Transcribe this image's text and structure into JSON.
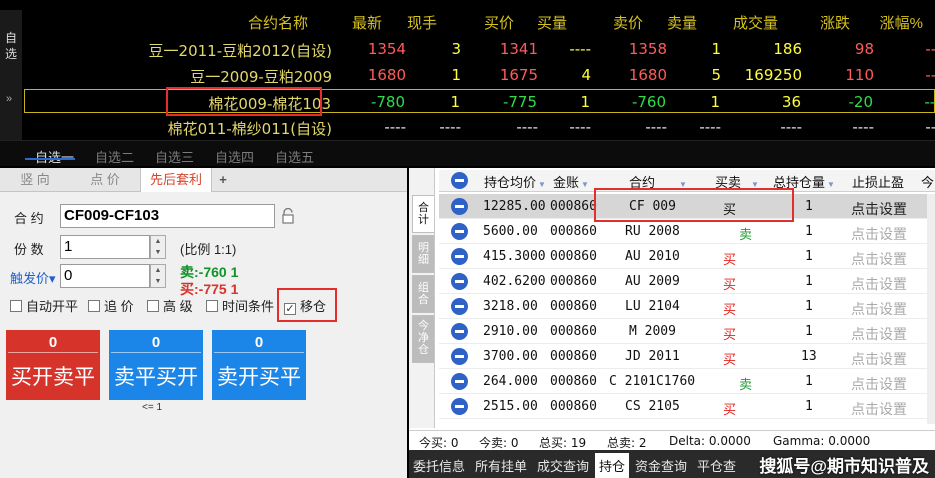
{
  "quote_board": {
    "side_tab": [
      "自",
      "选"
    ],
    "columns": [
      "合约名称",
      "最新",
      "现手",
      "买价",
      "买量",
      "卖价",
      "卖量",
      "成交量",
      "涨跌",
      "涨幅%"
    ],
    "rows": [
      {
        "name": "豆一2011-豆粕2012(自设)",
        "last": "1354",
        "vol": "3",
        "bid": "1341",
        "bid_qty": "----",
        "ask": "1358",
        "ask_qty": "1",
        "turnover": "186",
        "change": "98",
        "pct": "----"
      },
      {
        "name": "豆一2009-豆粕2009",
        "last": "1680",
        "vol": "1",
        "bid": "1675",
        "bid_qty": "4",
        "ask": "1680",
        "ask_qty": "5",
        "turnover": "169250",
        "change": "110",
        "pct": "----"
      },
      {
        "name": "棉花009-棉花103",
        "last": "-780",
        "vol": "1",
        "bid": "-775",
        "bid_qty": "1",
        "ask": "-760",
        "ask_qty": "1",
        "turnover": "36",
        "change": "-20",
        "pct": "----"
      },
      {
        "name": "棉花011-棉纱011(自设)",
        "last": "----",
        "vol": "----",
        "bid": "----",
        "bid_qty": "----",
        "ask": "----",
        "ask_qty": "----",
        "turnover": "----",
        "change": "----",
        "pct": "----"
      }
    ],
    "chevron": "»"
  },
  "watchlist_tabs": [
    "自选一",
    "自选二",
    "自选三",
    "自选四",
    "自选五"
  ],
  "order_panel": {
    "tabs": [
      "竖 向",
      "点 价",
      "先后套利",
      "+"
    ],
    "contract_label": "合 约",
    "contract_value": "CF009-CF103",
    "lots_label": "份 数",
    "lots_value": "1",
    "ratio": "(比例 1:1)",
    "trigger_label": "触发价▾",
    "trigger_value": "0",
    "sell_quote": "卖:-760  1",
    "buy_quote": "买:-775  1",
    "checkboxes": [
      {
        "label": "自动开平",
        "checked": false
      },
      {
        "label": "追 价",
        "checked": false
      },
      {
        "label": "高 级",
        "checked": false
      },
      {
        "label": "时间条件",
        "checked": false
      },
      {
        "label": "移仓",
        "checked": true
      }
    ],
    "buttons": [
      {
        "qty": "0",
        "label": "买开卖平",
        "color": "#d6332b"
      },
      {
        "qty": "0",
        "label": "卖平买开",
        "color": "#1c86e8"
      },
      {
        "qty": "0",
        "label": "卖开买平",
        "color": "#1c86e8"
      }
    ],
    "note": "<= 1",
    "lock_icon": "lock-icon",
    "checkmark": "✓"
  },
  "positions": {
    "side_tabs": [
      "合计",
      "明细",
      "组合",
      "今净仓"
    ],
    "columns": [
      "持仓均价",
      "金账",
      "合约",
      "买卖",
      "总持仓量",
      "止损止盈",
      "今"
    ],
    "rows": [
      {
        "avg": "12285.00",
        "acct": "000860",
        "contract": "CF  009",
        "side": "买",
        "qty": "1",
        "stop": "点击设置"
      },
      {
        "avg": "5600.00",
        "acct": "000860",
        "contract": "RU  2008",
        "side": "卖",
        "qty": "1",
        "stop": "点击设置"
      },
      {
        "avg": "415.3000",
        "acct": "000860",
        "contract": "AU  2010",
        "side": "买",
        "qty": "1",
        "stop": "点击设置"
      },
      {
        "avg": "402.6200",
        "acct": "000860",
        "contract": "AU  2009",
        "side": "买",
        "qty": "1",
        "stop": "点击设置"
      },
      {
        "avg": "3218.00",
        "acct": "000860",
        "contract": "LU  2104",
        "side": "买",
        "qty": "1",
        "stop": "点击设置"
      },
      {
        "avg": "2910.00",
        "acct": "000860",
        "contract": "M  2009",
        "side": "买",
        "qty": "1",
        "stop": "点击设置"
      },
      {
        "avg": "3700.00",
        "acct": "000860",
        "contract": "JD  2011",
        "side": "买",
        "qty": "13",
        "stop": "点击设置"
      },
      {
        "avg": "264.000",
        "acct": "000860",
        "contract": "C  2101C1760",
        "side": "卖",
        "qty": "1",
        "stop": "点击设置"
      },
      {
        "avg": "2515.00",
        "acct": "000860",
        "contract": "CS  2105",
        "side": "买",
        "qty": "1",
        "stop": "点击设置"
      }
    ],
    "summary": [
      "今买:  0",
      "今卖:  0",
      "总买:  19",
      "总卖:  2",
      "Delta:  0.0000",
      "Gamma:  0.0000"
    ],
    "bottom_tabs": [
      "委托信息",
      "所有挂单",
      "成交查询",
      "持仓",
      "资金查询",
      "平仓查"
    ],
    "watermark": "搜狐号@期市知识普及"
  }
}
